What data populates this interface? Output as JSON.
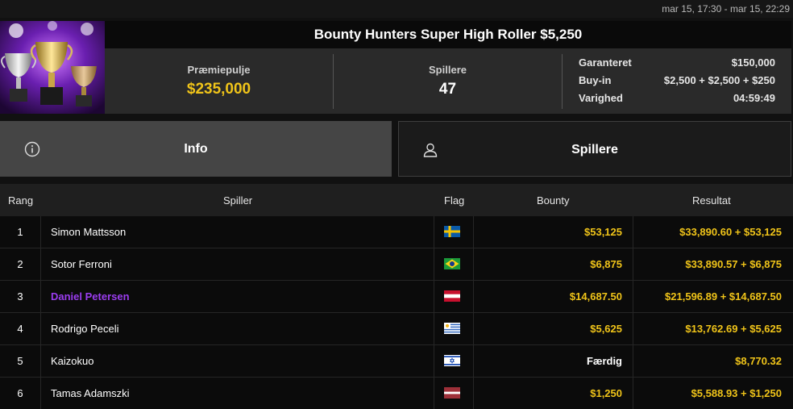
{
  "header": {
    "date_range": "mar 15, 17:30 - mar 15, 22:29",
    "title": "Bounty Hunters Super High Roller $5,250"
  },
  "colors": {
    "accent_gold": "#f0c419",
    "highlight_purple": "#9b3df0"
  },
  "stats": {
    "prize_pool_label": "Præmiepulje",
    "prize_pool_value": "$235,000",
    "players_label": "Spillere",
    "players_value": "47",
    "details": [
      {
        "label": "Garanteret",
        "value": "$150,000"
      },
      {
        "label": "Buy-in",
        "value": "$2,500 + $2,500 + $250"
      },
      {
        "label": "Varighed",
        "value": "04:59:49"
      }
    ]
  },
  "tabs": [
    {
      "label": "Info",
      "icon": "info-icon",
      "active": true
    },
    {
      "label": "Spillere",
      "icon": "user-icon",
      "active": false
    }
  ],
  "table": {
    "columns": [
      "Rang",
      "Spiller",
      "Flag",
      "Bounty",
      "Resultat"
    ],
    "rows": [
      {
        "rank": "1",
        "name": "Simon Mattsson",
        "flag": "sweden-flag",
        "bounty": "$53,125",
        "result": "$33,890.60 + $53,125"
      },
      {
        "rank": "2",
        "name": "Sotor Ferroni",
        "flag": "brazil-flag",
        "bounty": "$6,875",
        "result": "$33,890.57 + $6,875"
      },
      {
        "rank": "3",
        "name": "Daniel Petersen",
        "flag": "austria-flag",
        "bounty": "$14,687.50",
        "result": "$21,596.89 + $14,687.50"
      },
      {
        "rank": "4",
        "name": "Rodrigo Peceli",
        "flag": "uruguay-flag",
        "bounty": "$5,625",
        "result": "$13,762.69 + $5,625"
      },
      {
        "rank": "5",
        "name": "Kaizokuo",
        "flag": "israel-flag",
        "bounty": "Færdig",
        "result": "$8,770.32"
      },
      {
        "rank": "6",
        "name": "Tamas Adamszki",
        "flag": "latvia-flag",
        "bounty": "$1,250",
        "result": "$5,588.93 + $1,250"
      }
    ]
  }
}
